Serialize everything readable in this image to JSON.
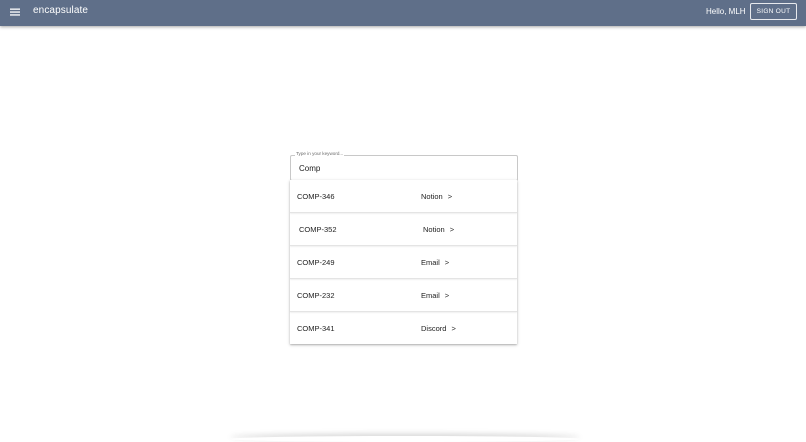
{
  "appbar": {
    "menu_icon": "hamburger-menu-icon",
    "brand": "encapsulate",
    "greeting": "Hello, MLH",
    "signout_label": "SIGN OUT",
    "background_color": "#5f6f89"
  },
  "search": {
    "label": "Type in your keyword...",
    "value": "Comp"
  },
  "results": [
    {
      "id": "COMP-346",
      "source": "Notion",
      "chevron": ">"
    },
    {
      "id": "COMP-352",
      "source": "Notion",
      "chevron": ">"
    },
    {
      "id": "COMP-249",
      "source": "Email",
      "chevron": ">"
    },
    {
      "id": "COMP-232",
      "source": "Email",
      "chevron": ">"
    },
    {
      "id": "COMP-341",
      "source": "Discord",
      "chevron": ">"
    }
  ]
}
